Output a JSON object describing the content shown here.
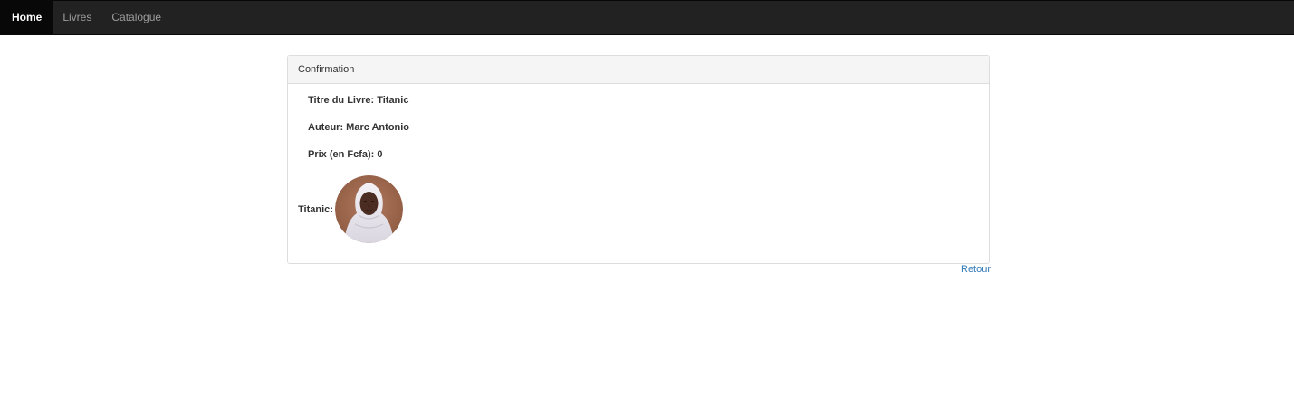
{
  "nav": {
    "items": [
      {
        "label": "Home",
        "active": true
      },
      {
        "label": "Livres",
        "active": false
      },
      {
        "label": "Catalogue",
        "active": false
      }
    ]
  },
  "panel": {
    "heading": "Confirmation",
    "title_line": "Titre du Livre: Titanic",
    "author_line": "Auteur: Marc Antonio",
    "price_line": "Prix (en Fcfa): 0",
    "image_label": "Titanic:"
  },
  "back_link": "Retour",
  "colors": {
    "navbar_bg": "#222222",
    "navbar_active_bg": "#080808",
    "link": "#337ab7",
    "panel_heading_bg": "#f5f5f5"
  }
}
